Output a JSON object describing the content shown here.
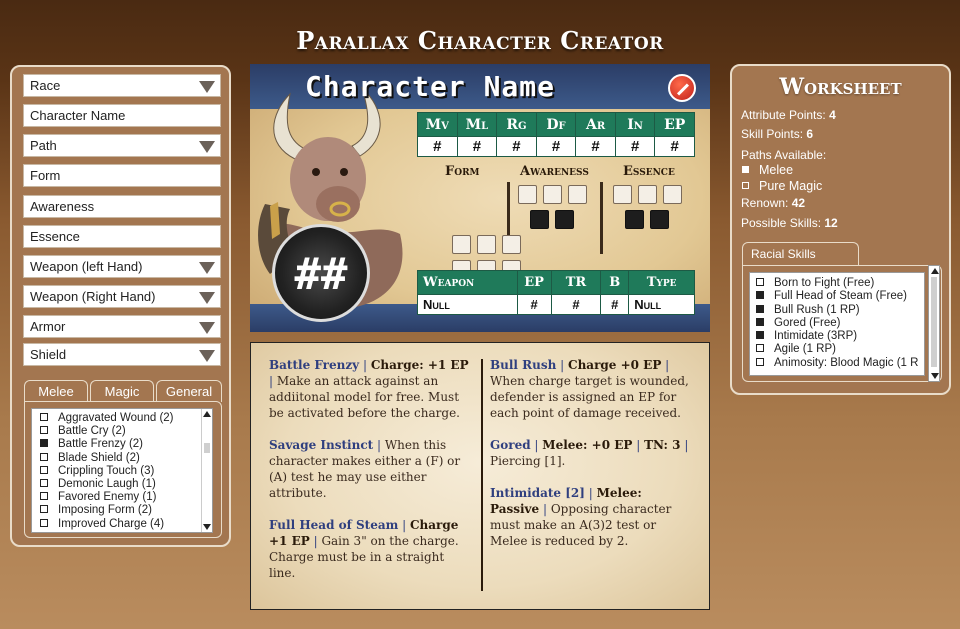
{
  "app": {
    "title": "Parallax Character Creator"
  },
  "form": {
    "race": "Race",
    "character_name": "Character Name",
    "path": "Path",
    "form": "Form",
    "awareness": "Awareness",
    "essence": "Essence",
    "weapon_left": "Weapon (left Hand)",
    "weapon_right": "Weapon (Right Hand)",
    "armor": "Armor",
    "shield": "Shield"
  },
  "skill_tabs": [
    "Melee",
    "Magic",
    "General"
  ],
  "skill_list": [
    {
      "label": "Aggravated Wound (2)",
      "checked": false
    },
    {
      "label": "Battle Cry (2)",
      "checked": false
    },
    {
      "label": "Battle Frenzy (2)",
      "checked": true
    },
    {
      "label": "Blade Shield (2)",
      "checked": false
    },
    {
      "label": "Crippling Touch (3)",
      "checked": false
    },
    {
      "label": "Demonic Laugh (1)",
      "checked": false
    },
    {
      "label": "Favored Enemy (1)",
      "checked": false
    },
    {
      "label": "Imposing Form (2)",
      "checked": false
    },
    {
      "label": "Improved Charge  (4)",
      "checked": false
    }
  ],
  "card": {
    "name": "Character Name",
    "badge": "##",
    "stat_headers": [
      "Mv",
      "Ml",
      "Rg",
      "Df",
      "Ar",
      "In",
      "EP"
    ],
    "stat_values": [
      "#",
      "#",
      "#",
      "#",
      "#",
      "#",
      "#"
    ],
    "attr_headers": [
      "Form",
      "Awareness",
      "Essence"
    ],
    "weapon_headers": [
      "Weapon",
      "EP",
      "TR",
      "B",
      "Type"
    ],
    "weapon_row": [
      "Null",
      "#",
      "#",
      "#",
      "Null"
    ]
  },
  "descriptions": {
    "left": [
      {
        "name": "Battle Frenzy",
        "rest": "Charge: +1 EP",
        "body": "Make an attack against an addiitonal model for free.  Must be activated before the charge."
      },
      {
        "name": "Savage Instinct",
        "rest": "",
        "body": "When this character makes either a (F) or (A) test he may use either attribute."
      },
      {
        "name": "Full Head of Steam",
        "rest": "Charge +1 EP",
        "body": "Gain 3\" on the charge.  Charge must be in a straight line."
      }
    ],
    "right": [
      {
        "name": "Bull Rush",
        "rest": "Charge +0 EP",
        "body": "When charge target is wounded, defender is assigned an EP for each point of damage received."
      },
      {
        "name": "Gored",
        "rest": "Melee: +0 EP",
        "extra": "TN: 3",
        "body": "Piercing [1]."
      },
      {
        "name": "Intimidate [2]",
        "rest": "Melee: Passive",
        "body": "Opposing character must make an A(3)2 test or Melee is reduced by 2."
      }
    ]
  },
  "worksheet": {
    "title": "Worksheet",
    "attribute_points_label": "Attribute Points:",
    "attribute_points": "4",
    "skill_points_label": "Skill Points:",
    "skill_points": "6",
    "paths_label": "Paths Available:",
    "paths": [
      {
        "label": "Melee",
        "checked": true
      },
      {
        "label": "Pure Magic",
        "checked": false
      }
    ],
    "renown_label": "Renown:",
    "renown": "42",
    "possible_skills_label": "Possible Skills:",
    "possible_skills": "12",
    "racial_tab": "Racial Skills",
    "racial_skills": [
      {
        "label": "Born to Fight (Free)",
        "checked": false
      },
      {
        "label": "Full Head of Steam (Free)",
        "checked": true
      },
      {
        "label": "Bull Rush (1 RP)",
        "checked": true
      },
      {
        "label": "Gored (Free)",
        "checked": true
      },
      {
        "label": "Intimidate (3RP)",
        "checked": true
      },
      {
        "label": "Agile (1 RP)",
        "checked": false
      },
      {
        "label": "Animosity: Blood Magic (1 R",
        "checked": false
      }
    ]
  },
  "colors": {
    "panel": "#a37650",
    "card_header": "#1f7a5a",
    "skill_name": "#2f3f7f"
  }
}
